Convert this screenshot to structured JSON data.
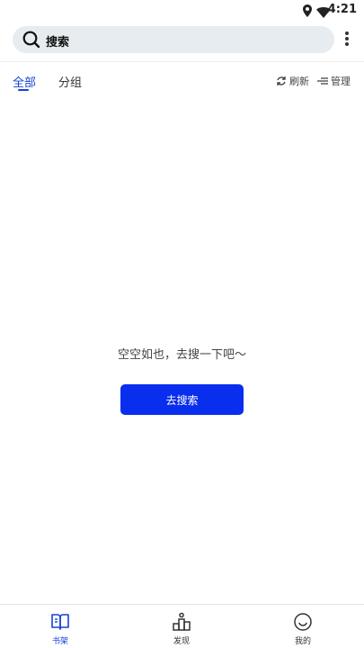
{
  "status_bar": {
    "time": "4:21"
  },
  "search": {
    "label": "搜索"
  },
  "tabs": [
    {
      "label": "全部",
      "active": true
    },
    {
      "label": "分组",
      "active": false
    }
  ],
  "actions": {
    "refresh": "刷新",
    "manage": "管理"
  },
  "empty_state": {
    "message": "空空如也，去搜一下吧〜",
    "button": "去搜索"
  },
  "bottom_nav": [
    {
      "label": "书架",
      "icon": "book-icon",
      "active": true
    },
    {
      "label": "发现",
      "icon": "discover-icon",
      "active": false
    },
    {
      "label": "我的",
      "icon": "smile-icon",
      "active": false
    }
  ],
  "colors": {
    "accent": "#1742d6",
    "button": "#0a2eee",
    "search_bg": "#e6ecef"
  }
}
